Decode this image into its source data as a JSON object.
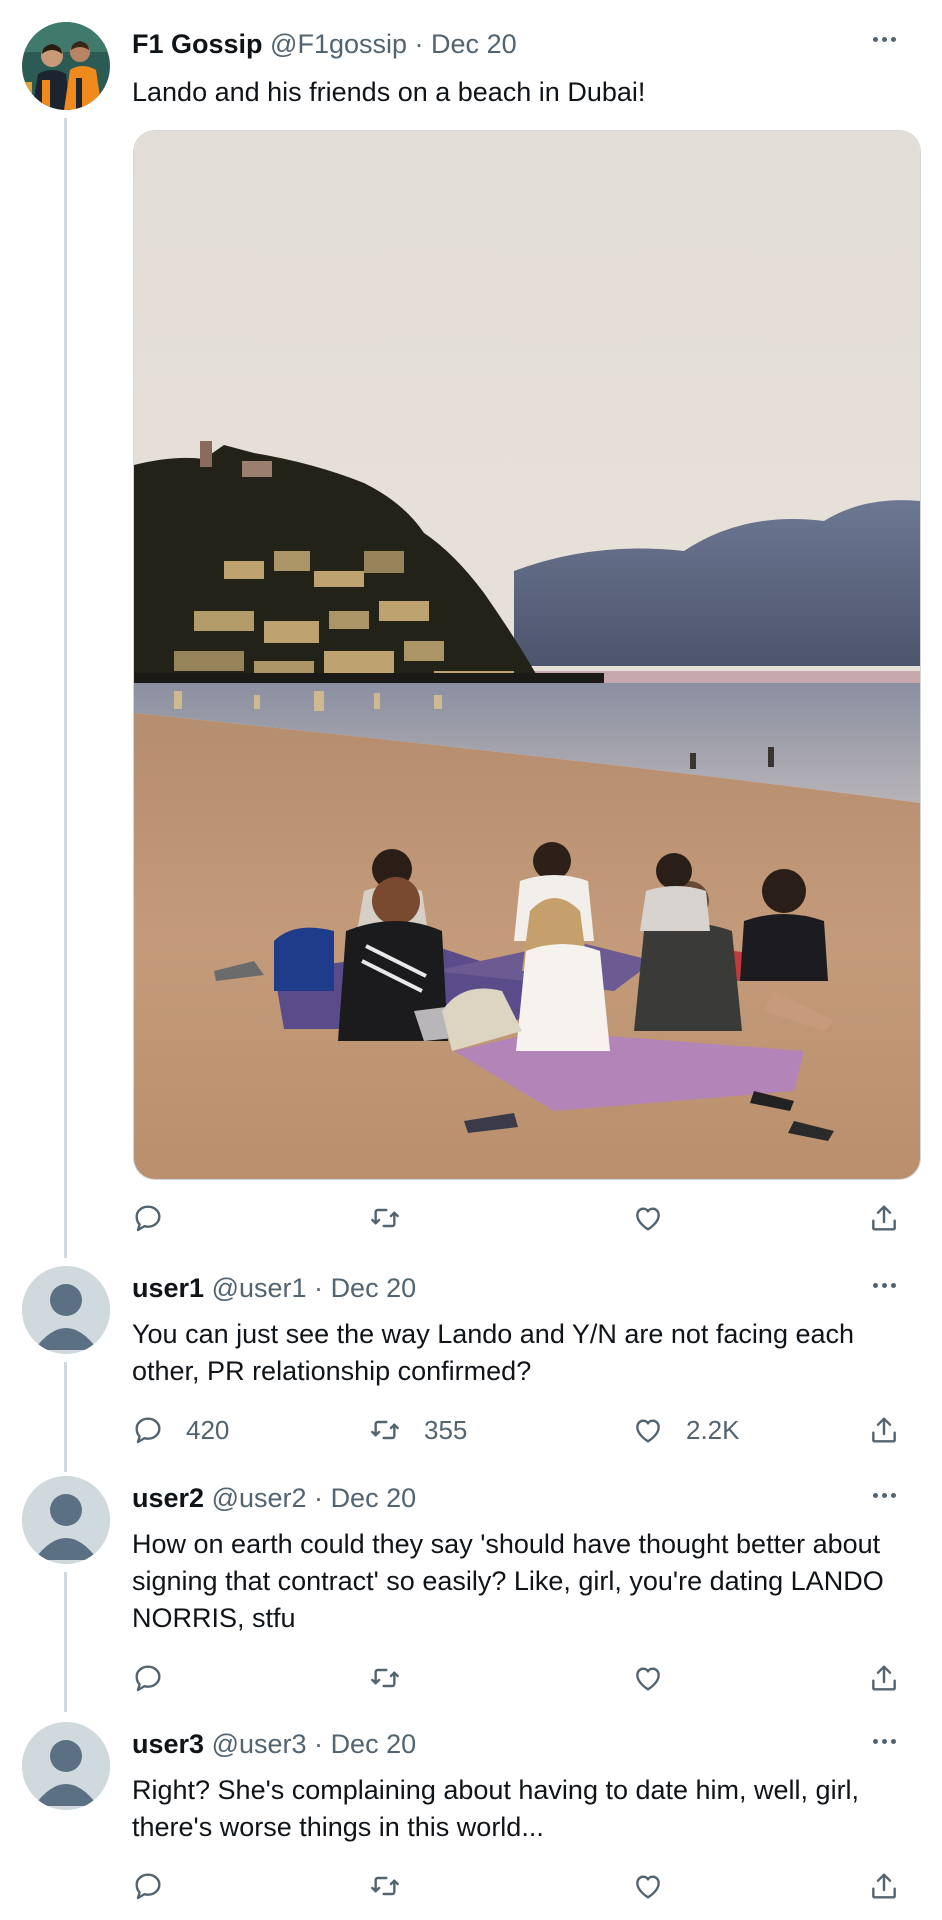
{
  "tweets": [
    {
      "name": "F1 Gossip",
      "handle": "@F1gossip",
      "separator": "·",
      "date": "Dec 20",
      "text": "Lando and his friends on a beach in Dubai!",
      "has_media": true,
      "counts": {
        "reply": "",
        "retweet": "",
        "like": ""
      }
    },
    {
      "name": "user1",
      "handle": "@user1",
      "separator": "·",
      "date": "Dec 20",
      "text": "You can just see the way Lando and Y/N are not facing each other, PR relationship confirmed?",
      "counts": {
        "reply": "420",
        "retweet": "355",
        "like": "2.2K"
      }
    },
    {
      "name": "user2",
      "handle": "@user2",
      "separator": "·",
      "date": "Dec 20",
      "text": "How on earth could they say 'should have thought better about signing that contract' so easily? Like, girl, you're dating LANDO NORRIS, stfu",
      "counts": {
        "reply": "",
        "retweet": "",
        "like": ""
      }
    },
    {
      "name": "user3",
      "handle": "@user3",
      "separator": "·",
      "date": "Dec 20",
      "text": "Right? She's complaining about having to date him, well, girl, there's worse things in this world...",
      "counts": {
        "reply": "",
        "retweet": "",
        "like": ""
      }
    }
  ],
  "colors": {
    "text_primary": "#0f1419",
    "text_secondary": "#536471",
    "thread_line": "#cfd9de",
    "avatar_default_bg": "#cfd9de",
    "avatar_default_fg": "#5b7083"
  },
  "icons": {
    "reply": "reply-icon",
    "retweet": "retweet-icon",
    "like": "heart-icon",
    "share": "share-icon",
    "more": "more-icon"
  }
}
